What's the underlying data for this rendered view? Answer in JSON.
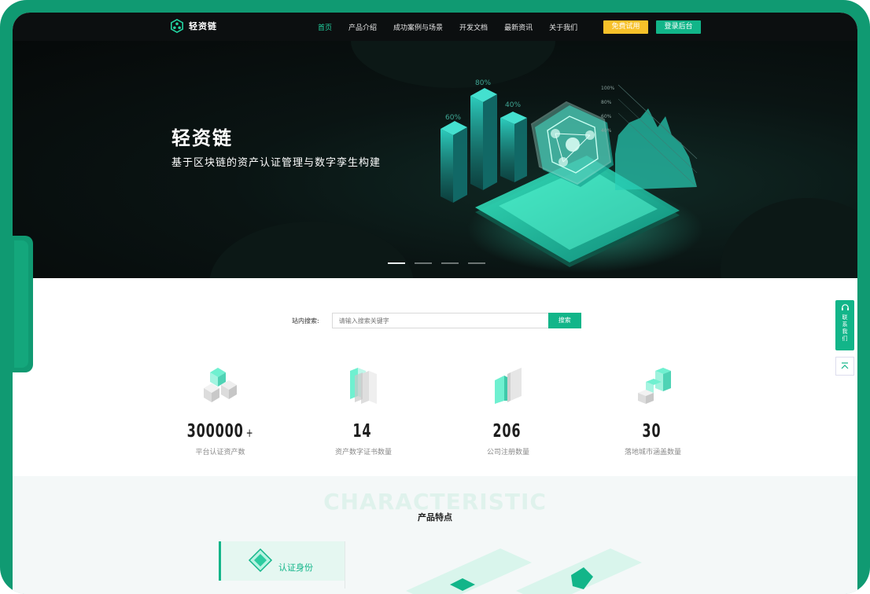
{
  "brand": {
    "name": "轻资链"
  },
  "nav": {
    "items": [
      {
        "label": "首页",
        "active": true
      },
      {
        "label": "产品介绍"
      },
      {
        "label": "成功案例与场景"
      },
      {
        "label": "开发文档"
      },
      {
        "label": "最新资讯"
      },
      {
        "label": "关于我们"
      }
    ],
    "trial_label": "免费试用",
    "login_label": "登录后台"
  },
  "hero": {
    "title": "轻资链",
    "subtitle": "基于区块链的资产认证管理与数字孪生构建",
    "chart_labels": [
      "60%",
      "80%",
      "40%"
    ],
    "axis_labels": [
      "100%",
      "80%",
      "60%",
      "40%"
    ],
    "slides": 4,
    "active_slide": 0
  },
  "search": {
    "label": "站内搜索:",
    "placeholder": "请输入搜索关键字",
    "button": "搜索"
  },
  "stats": [
    {
      "value": "300000",
      "suffix": "+",
      "label": "平台认证资产数",
      "icon": "cube-stack-icon"
    },
    {
      "value": "14",
      "suffix": "",
      "label": "资产数字证书数量",
      "icon": "certificate-stack-icon"
    },
    {
      "value": "206",
      "suffix": "",
      "label": "公司注册数量",
      "icon": "building-icon"
    },
    {
      "value": "30",
      "suffix": "",
      "label": "落地城市涵盖数量",
      "icon": "city-blocks-icon"
    }
  ],
  "characteristics": {
    "bg_text": "CHARACTERISTIC",
    "title": "产品特点",
    "tabs": [
      {
        "label": "认证身份",
        "icon": "diamond-icon"
      }
    ]
  },
  "float": {
    "contact_label": "联系我们",
    "top_icon": "back-to-top-icon"
  },
  "colors": {
    "accent": "#12b589",
    "trial": "#f7c12a",
    "frame": "#109a72",
    "nav_bg": "#0c0f10"
  }
}
